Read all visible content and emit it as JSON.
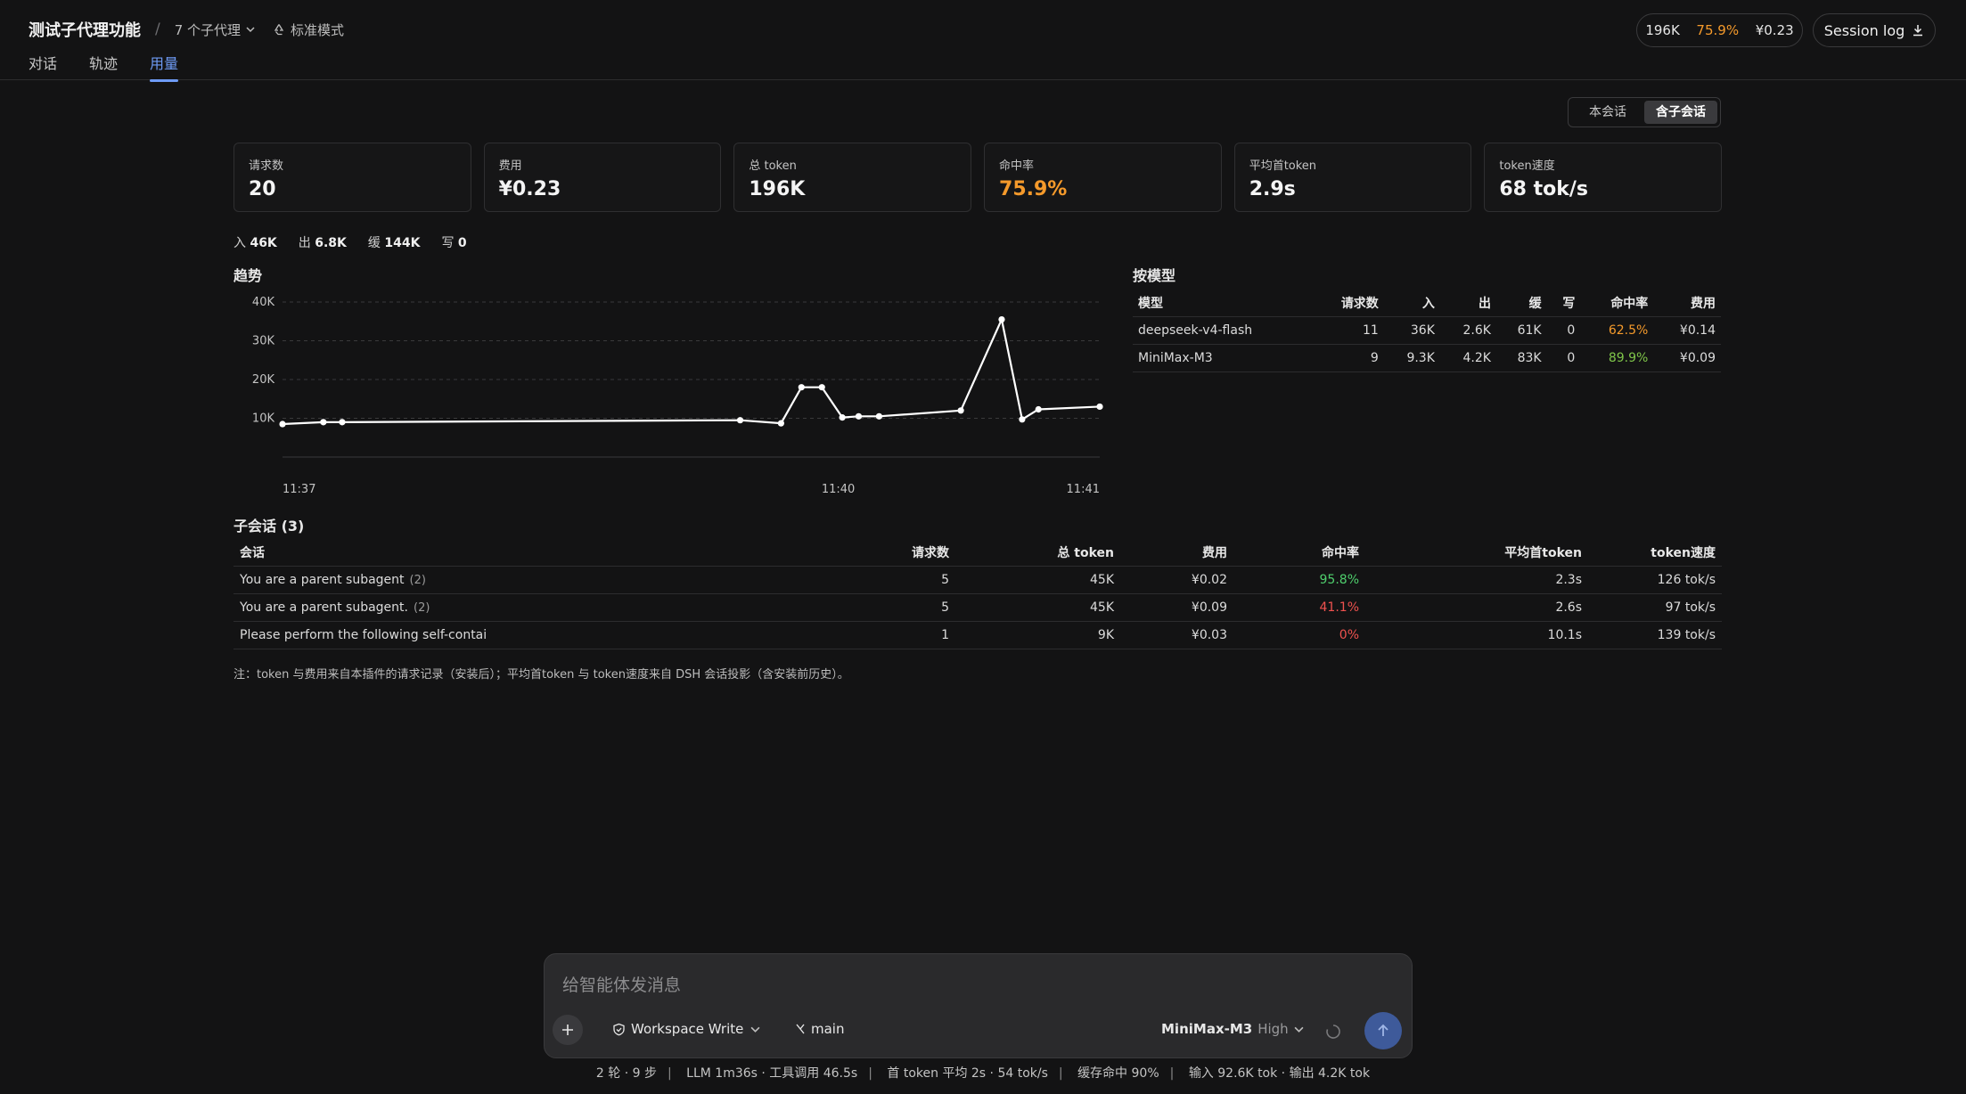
{
  "header": {
    "title": "测试子代理功能",
    "separator": "/",
    "agents": "7 个子代理",
    "mode": "标准模式",
    "tabs": [
      "对话",
      "轨迹",
      "用量"
    ],
    "active_tab": "用量",
    "stats": {
      "tokens": "196K",
      "hit_rate": "75.9%",
      "cost": "¥0.23"
    },
    "session_log": "Session log"
  },
  "scope": {
    "options": [
      "本会话",
      "含子会话"
    ],
    "active": "含子会话"
  },
  "cards": [
    {
      "label": "请求数",
      "value": "20"
    },
    {
      "label": "费用",
      "value": "¥0.23"
    },
    {
      "label": "总 token",
      "value": "196K"
    },
    {
      "label": "命中率",
      "value": "75.9%",
      "color": "#f59a2b"
    },
    {
      "label": "平均首token",
      "value": "2.9s"
    },
    {
      "label": "token速度",
      "value": "68 tok/s"
    }
  ],
  "io": [
    {
      "label": "入",
      "value": "46K"
    },
    {
      "label": "出",
      "value": "6.8K"
    },
    {
      "label": "缓",
      "value": "144K"
    },
    {
      "label": "写",
      "value": "0"
    }
  ],
  "trend_title": "趋势",
  "chart_data": {
    "type": "line",
    "y_ticks": [
      "40K",
      "30K",
      "20K",
      "10K"
    ],
    "ylim": [
      0,
      40000
    ],
    "x_tick_labels": [
      "11:37",
      "11:40",
      "11:41"
    ],
    "x_tick_positions": [
      0,
      0.68,
      1
    ],
    "grid": true,
    "series": [
      {
        "x": [
          0,
          0.05,
          0.073,
          0.56,
          0.61,
          0.635,
          0.66,
          0.685,
          0.705,
          0.73,
          0.83,
          0.88,
          0.905,
          0.925,
          1.0
        ],
        "values": [
          8500,
          9000,
          9000,
          9500,
          8700,
          18000,
          18000,
          10200,
          10500,
          10500,
          12000,
          35500,
          9700,
          12300,
          13000
        ]
      }
    ]
  },
  "model_table": {
    "title": "按模型",
    "headers": [
      "模型",
      "请求数",
      "入",
      "出",
      "缓",
      "写",
      "命中率",
      "费用"
    ],
    "rows": [
      {
        "cells": [
          "deepseek-v4-flash",
          "11",
          "36K",
          "2.6K",
          "61K",
          "0",
          "62.5%",
          "¥0.14"
        ],
        "rate_color": "orange"
      },
      {
        "cells": [
          "MiniMax-M3",
          "9",
          "9.3K",
          "4.2K",
          "83K",
          "0",
          "89.9%",
          "¥0.09"
        ],
        "rate_color": "green"
      }
    ]
  },
  "sub_table": {
    "title": "子会话 (3)",
    "headers": [
      "会话",
      "请求数",
      "总 token",
      "费用",
      "命中率",
      "平均首token",
      "token速度"
    ],
    "rows": [
      {
        "name": "You are a parent subagent",
        "count": "(2)",
        "cells": [
          "5",
          "45K",
          "¥0.02",
          "95.8%",
          "2.3s",
          "126 tok/s"
        ],
        "rate_color": "green2"
      },
      {
        "name": "You are a parent subagent.",
        "count": "(2)",
        "cells": [
          "5",
          "45K",
          "¥0.09",
          "41.1%",
          "2.6s",
          "97 tok/s"
        ],
        "rate_color": "red"
      },
      {
        "name": "Please perform the following self-contai",
        "count": "",
        "cells": [
          "1",
          "9K",
          "¥0.03",
          "0%",
          "10.1s",
          "139 tok/s"
        ],
        "rate_color": "red"
      }
    ]
  },
  "note": "注：token 与费用来自本插件的请求记录（安装后）；平均首token 与 token速度来自 DSH 会话投影（含安装前历史）。",
  "composer": {
    "placeholder": "给智能体发消息",
    "workspace": "Workspace Write",
    "branch": "main",
    "model": "MiniMax-M3",
    "level": "High"
  },
  "footer": [
    "2 轮 · 9 步",
    "LLM 1m36s · 工具调用 46.5s",
    "首 token 平均 2s · 54 tok/s",
    "缓存命中 90%",
    "输入 92.6K tok · 输出 4.2K tok"
  ]
}
